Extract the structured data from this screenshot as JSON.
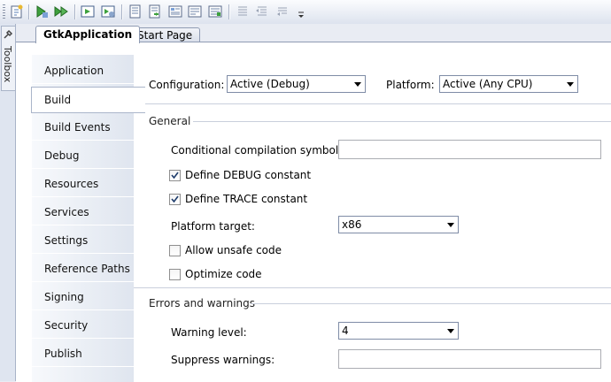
{
  "toolbar": {
    "icons": [
      "build-project-icon",
      "start-icon",
      "start-without-debugging-icon",
      "attach-process-icon",
      "debug-settings-icon",
      "form-icon",
      "form-add-icon",
      "properties-icon",
      "toolbox-list-icon",
      "class-view-icon",
      "indent-icon",
      "outdent-icon",
      "comment-icon",
      "overflow-chevron-icon"
    ]
  },
  "toolbox": {
    "label": "Toolbox"
  },
  "tabs": [
    {
      "label": "GtkApplication",
      "active": true
    },
    {
      "label": "Start Page",
      "active": false
    }
  ],
  "sidebar": {
    "items": [
      {
        "label": "Application"
      },
      {
        "label": "Build",
        "selected": true
      },
      {
        "label": "Build Events"
      },
      {
        "label": "Debug"
      },
      {
        "label": "Resources"
      },
      {
        "label": "Services"
      },
      {
        "label": "Settings"
      },
      {
        "label": "Reference Paths"
      },
      {
        "label": "Signing"
      },
      {
        "label": "Security"
      },
      {
        "label": "Publish"
      }
    ]
  },
  "config": {
    "configuration_label": "Configuration:",
    "configuration_value": "Active (Debug)",
    "platform_label": "Platform:",
    "platform_value": "Active (Any CPU)"
  },
  "general": {
    "section_title": "General",
    "conditional_label": "Conditional compilation symbols:",
    "conditional_value": "",
    "define_debug_label": "Define DEBUG constant",
    "define_debug_checked": true,
    "define_trace_label": "Define TRACE constant",
    "define_trace_checked": true,
    "platform_target_label": "Platform target:",
    "platform_target_value": "x86",
    "unsafe_label": "Allow unsafe code",
    "unsafe_checked": false,
    "optimize_label": "Optimize code",
    "optimize_checked": false
  },
  "errors": {
    "section_title": "Errors and warnings",
    "warning_level_label": "Warning level:",
    "warning_level_value": "4",
    "suppress_label": "Suppress warnings:",
    "suppress_value": ""
  }
}
